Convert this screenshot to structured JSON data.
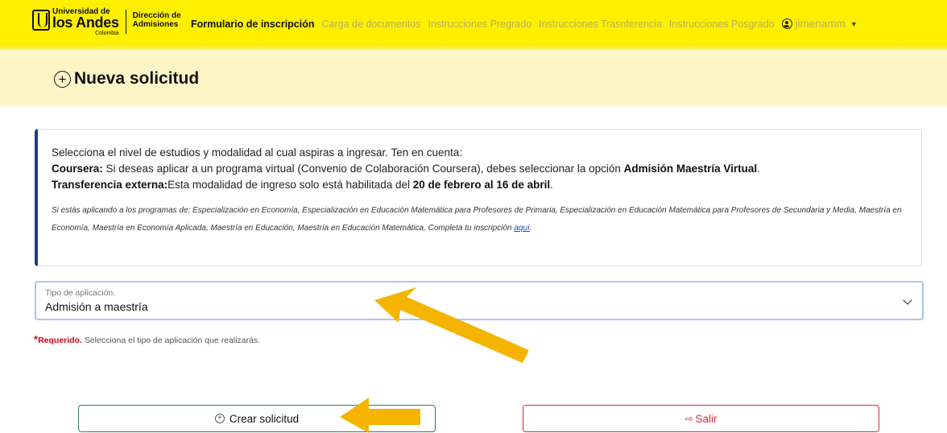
{
  "navbar": {
    "logo": {
      "university_line": "Universidad de",
      "name_line": "los Andes",
      "country": "Colombia",
      "department_line1": "Dirección de",
      "department_line2": "Admisiones"
    },
    "links": [
      {
        "label": "Formulario de inscripción",
        "active": true
      },
      {
        "label": "Carga de documentos",
        "active": false
      },
      {
        "label": "Instrucciones Pregrado",
        "active": false
      },
      {
        "label": "Instrucciones Trasnferencia",
        "active": false
      },
      {
        "label": "Instrucciones Posgrado",
        "active": false
      }
    ],
    "user": {
      "name": "jimenamm",
      "icon": "user-circle-icon"
    }
  },
  "page_title": "Nueva solicitud",
  "info": {
    "intro": "Selecciona el nivel de estudios y modalidad al cual aspiras a ingresar. Ten en cuenta:",
    "coursera_label": "Coursera:",
    "coursera_text": " Si deseas aplicar a un programa virtual (Convenio de Colaboración Coursera), debes seleccionar la opción ",
    "coursera_option": "Admisión Maestría Virtual",
    "coursera_end": ".",
    "transfer_label": "Transferencia externa:",
    "transfer_text": "Esta modalidad de ingreso solo está habilitada del ",
    "transfer_dates": "20 de febrero al 16 de abril",
    "transfer_end": ".",
    "small_note": "Si estás aplicando a los programas de: Especialización en Economía, Especialización en Educación Matemática para Profesores de Primaria, Especialización en Educación Matemática para Profesores de Secundaria y Media, Maestría en Economía, Maestría en Economía Aplicada, Maestría en Educación, Maestría en Educación Matemática, Completa tu inscripción ",
    "small_note_link": "aquí",
    "small_note_end": "."
  },
  "application_type": {
    "label": "Tipo de aplicación.",
    "value": "Admisión a maestría"
  },
  "required_hint": {
    "star": "*",
    "word": "Requerido.",
    "text": " Selecciona el tipo de aplicación que realizarás."
  },
  "buttons": {
    "create": "Crear solicitud",
    "exit": "Salir"
  },
  "colors": {
    "navbar_bg": "#ffef00",
    "title_band_bg": "#fcf6c6",
    "info_accent": "#1c3f86",
    "create_border": "#2e7d5b",
    "exit_color": "#d62f3a",
    "annotation_arrow": "#f5b400"
  }
}
